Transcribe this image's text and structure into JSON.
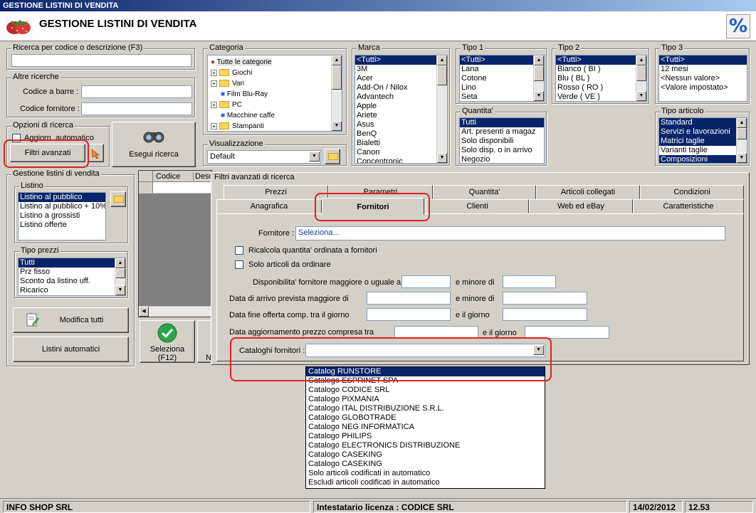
{
  "window_title": "GESTIONE LISTINI DI VENDITA",
  "header_title": "GESTIONE LISTINI DI VENDITA",
  "header_badge": "%",
  "search": {
    "legend": "Ricerca per codice o descrizione (F3)",
    "value": ""
  },
  "altre": {
    "legend": "Altre ricerche",
    "barcode_label": "Codice a barre :",
    "fornitore_label": "Codice fornitore :"
  },
  "opzioni": {
    "legend": "Opzioni di ricerca",
    "auto_update": "Aggiorn. automatico",
    "filtri_btn": "Filtri avanzati",
    "esegui_btn": "Esegui ricerca"
  },
  "categoria": {
    "legend": "Categoria",
    "items": [
      "Tutte le categorie",
      "Giochi",
      "Vari",
      "Film Blu-Ray",
      "PC",
      "Macchine caffe",
      "Stampanti"
    ]
  },
  "visualizzazione": {
    "legend": "Visualizzazione",
    "value": "Default"
  },
  "marca": {
    "legend": "Marca",
    "items": [
      "<Tutti>",
      "3M",
      "Acer",
      "Add-On / Nilox",
      "Advantech",
      "Apple",
      "Ariete",
      "Asus",
      "BenQ",
      "Bialetti",
      "Canon",
      "Concentronic"
    ]
  },
  "tipo1": {
    "legend": "Tipo 1",
    "items": [
      "<Tutti>",
      "Lana",
      "Cotone",
      "Lino",
      "Seta"
    ]
  },
  "tipo2": {
    "legend": "Tipo 2",
    "items": [
      "<Tutti>",
      "Bianco ( BI )",
      "Blu ( BL )",
      "Rosso ( RO )",
      "Verde ( VE )"
    ]
  },
  "tipo3": {
    "legend": "Tipo 3",
    "items": [
      "<Tutti>",
      "12 mesi",
      "<Nessun valore>",
      "<Valore impostato>"
    ]
  },
  "quantita": {
    "legend": "Quantita'",
    "items": [
      "Tutti",
      "Art. presenti a magaz",
      "Solo disponibili",
      "Solo disp. o in arrivo",
      "Negozio"
    ]
  },
  "tipo_articolo": {
    "legend": "Tipo articolo",
    "items": [
      "Standard",
      "Servizi e lavorazioni",
      "Matrici taglie",
      "Varianti taglie",
      "Composizioni"
    ]
  },
  "gestione": {
    "legend": "Gestione listini di vendita",
    "listino": {
      "legend": "Listino",
      "items": [
        "Listino al pubblico",
        "Listino al pubblico + 10%",
        "Listino a grossisti",
        "Listino offerte"
      ]
    },
    "tipo_prezzi": {
      "legend": "Tipo prezzi",
      "items": [
        "Tutti",
        "Prz fisso",
        "Sconto da listino uff.",
        "Ricarico"
      ]
    },
    "modifica_btn": "Modifica tutti",
    "automatici_btn": "Listini automatici"
  },
  "grid": {
    "columns": [
      "Codice",
      "Desc"
    ]
  },
  "seleziona_btn": "Seleziona\n(F12)",
  "hidden_btn_fragment": "N",
  "filtri": {
    "legend": "Filtri avanzati di ricerca",
    "tabs_back": [
      "Prezzi",
      "Parametri",
      "Quantita'",
      "Articoli collegati",
      "Condizioni"
    ],
    "tabs_front": [
      "Anagrafica",
      "Fornitori",
      "Clienti",
      "Web ed eBay",
      "Caratteristiche"
    ],
    "active_tab": "Fornitori",
    "fornitore_label": "Fornitore :",
    "fornitore_value": "Seleziona...",
    "ricalcola": "Ricalcola quantita' ordinata a fornitori",
    "solo_ordinare": "Solo articoli da ordinare",
    "disp_label": "Disponibilita' fornitore maggiore o uguale a",
    "disp_minore": "e minore di",
    "arrivo_label": "Data di arrivo prevista maggiore di",
    "arrivo_minore": "e minore di",
    "offerta_label": "Data fine offerta comp. tra il giorno",
    "offerta_giorno": "e il giorno",
    "aggiorn_label": "Data aggiornamento prezzo compresa tra",
    "aggiorn_giorno": "e il giorno",
    "cataloghi_label": "Cataloghi fornitori :",
    "cataloghi_options": [
      "Catalog RUNSTORE",
      "Catalogo ESPRINET SPA",
      "Catalogo CODICE SRL",
      "Catalogo PIXMANIA",
      "Catalogo ITAL DISTRIBUZIONE S.R.L.",
      "Catalogo GLOBOTRADE",
      "Catalogo NEG INFORMATICA",
      "Catalogo PHILIPS",
      "Catalogo ELECTRONICS DISTRIBUZIONE",
      "Catalogo CASEKING",
      "Catalogo CASEKING",
      "Solo articoli codificati in automatico",
      "Escludi articoli codificati in automatico"
    ]
  },
  "status": {
    "company": "INFO SHOP SRL",
    "license": "Intestatario licenza : CODICE SRL",
    "date": "14/02/2012",
    "time": "12.53"
  },
  "colors": {
    "selection": "#0a246a",
    "highlight_box": "#e02020",
    "title_gradient_start": "#0a246a"
  }
}
